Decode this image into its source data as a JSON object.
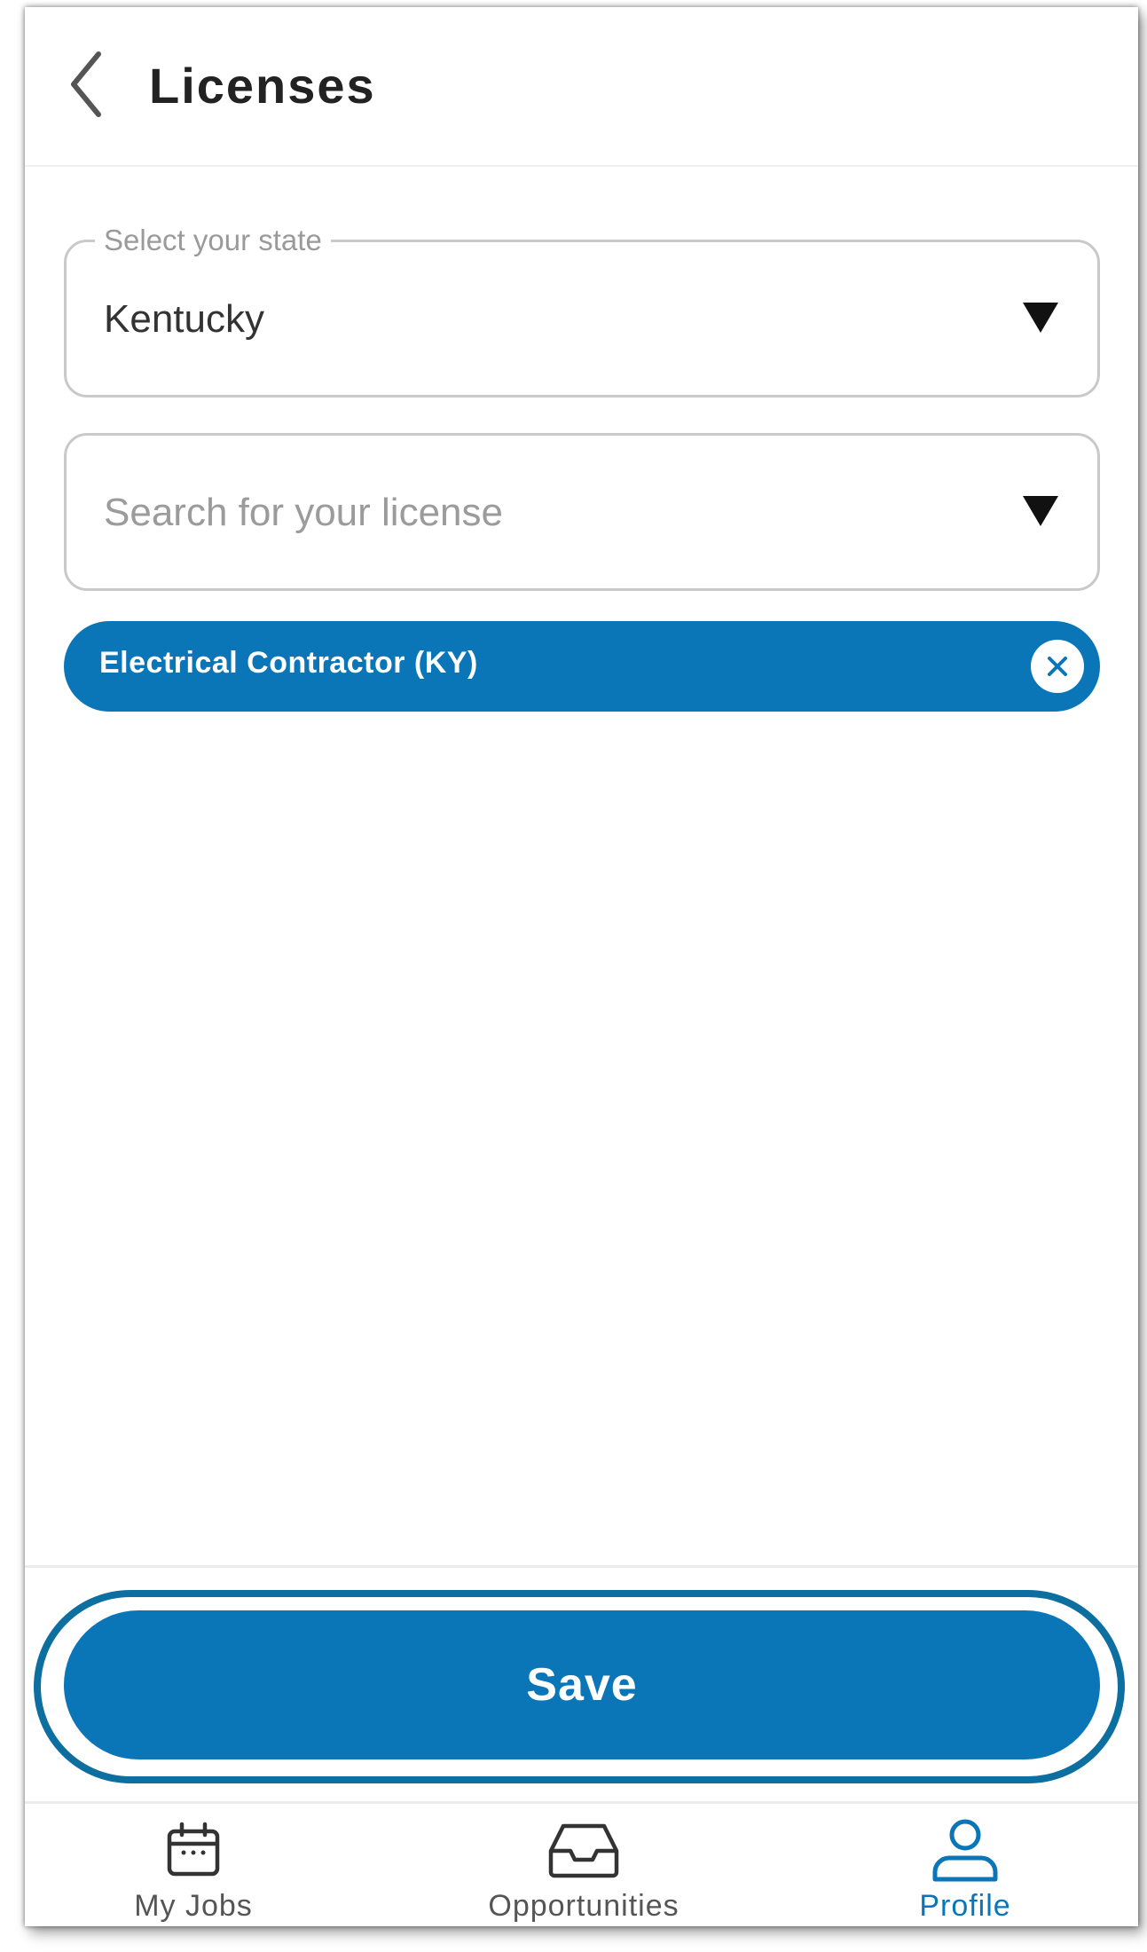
{
  "header": {
    "title": "Licenses"
  },
  "state_field": {
    "legend": "Select your state",
    "value": "Kentucky"
  },
  "license_field": {
    "placeholder": "Search for your license"
  },
  "selected_licenses": [
    {
      "label": "Electrical Contractor (KY)"
    }
  ],
  "actions": {
    "save_label": "Save"
  },
  "bottom_nav": {
    "items": [
      {
        "label": "My Jobs",
        "icon": "calendar-icon",
        "active": false
      },
      {
        "label": "Opportunities",
        "icon": "inbox-icon",
        "active": false
      },
      {
        "label": "Profile",
        "icon": "person-icon",
        "active": true
      }
    ]
  },
  "colors": {
    "primary": "#0a76b8",
    "highlight_ring": "#0d6ea0",
    "text_dark": "#222222",
    "text_muted": "#9b9b9b"
  }
}
